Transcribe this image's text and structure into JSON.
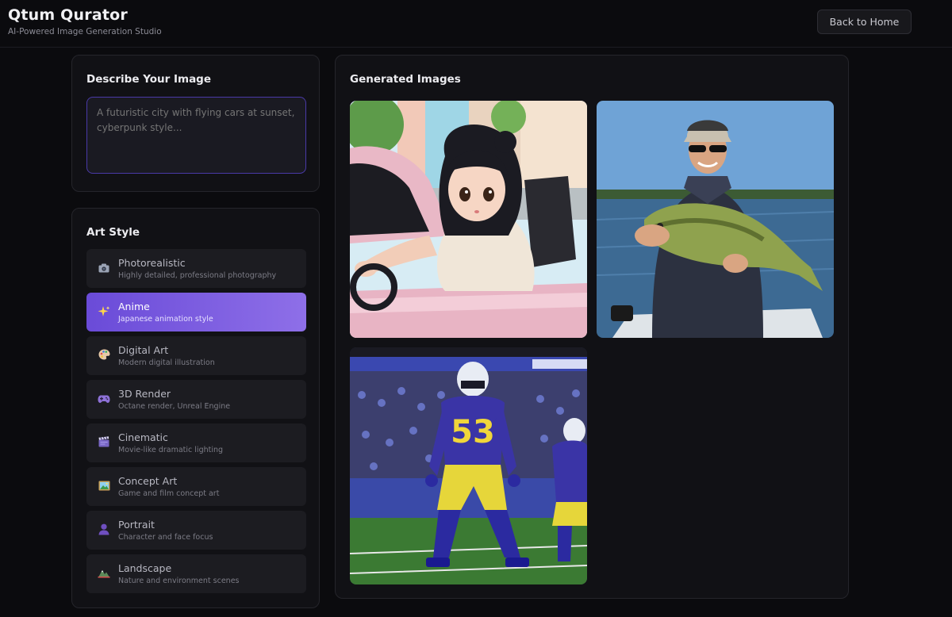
{
  "header": {
    "title": "Qtum Qurator",
    "subtitle": "AI-Powered Image Generation Studio",
    "back_label": "Back to Home"
  },
  "describe": {
    "title": "Describe Your Image",
    "placeholder": "A futuristic city with flying cars at sunset, cyberpunk style..."
  },
  "art_style": {
    "title": "Art Style",
    "selected": "Anime",
    "items": [
      {
        "icon": "camera-icon",
        "label": "Photorealistic",
        "description": "Highly detailed, professional photography"
      },
      {
        "icon": "sparkles-icon",
        "label": "Anime",
        "description": "Japanese animation style"
      },
      {
        "icon": "palette-icon",
        "label": "Digital Art",
        "description": "Modern digital illustration"
      },
      {
        "icon": "gamepad-icon",
        "label": "3D Render",
        "description": "Octane render, Unreal Engine"
      },
      {
        "icon": "clapperboard-icon",
        "label": "Cinematic",
        "description": "Movie-like dramatic lighting"
      },
      {
        "icon": "framed-picture-icon",
        "label": "Concept Art",
        "description": "Game and film concept art"
      },
      {
        "icon": "person-silhouette-icon",
        "label": "Portrait",
        "description": "Character and face focus"
      },
      {
        "icon": "mountain-icon",
        "label": "Landscape",
        "description": "Nature and environment scenes"
      }
    ]
  },
  "gallery": {
    "title": "Generated Images",
    "images": [
      {
        "subject": "anime-girl-convertible"
      },
      {
        "subject": "man-holding-bass-fish"
      },
      {
        "subject": "football-player-53",
        "jersey_number": "53"
      }
    ]
  },
  "colors": {
    "accent": "#7c5ce0",
    "accent_border": "#4a3aa8",
    "background": "#0b0b0e",
    "card": "#111115"
  }
}
